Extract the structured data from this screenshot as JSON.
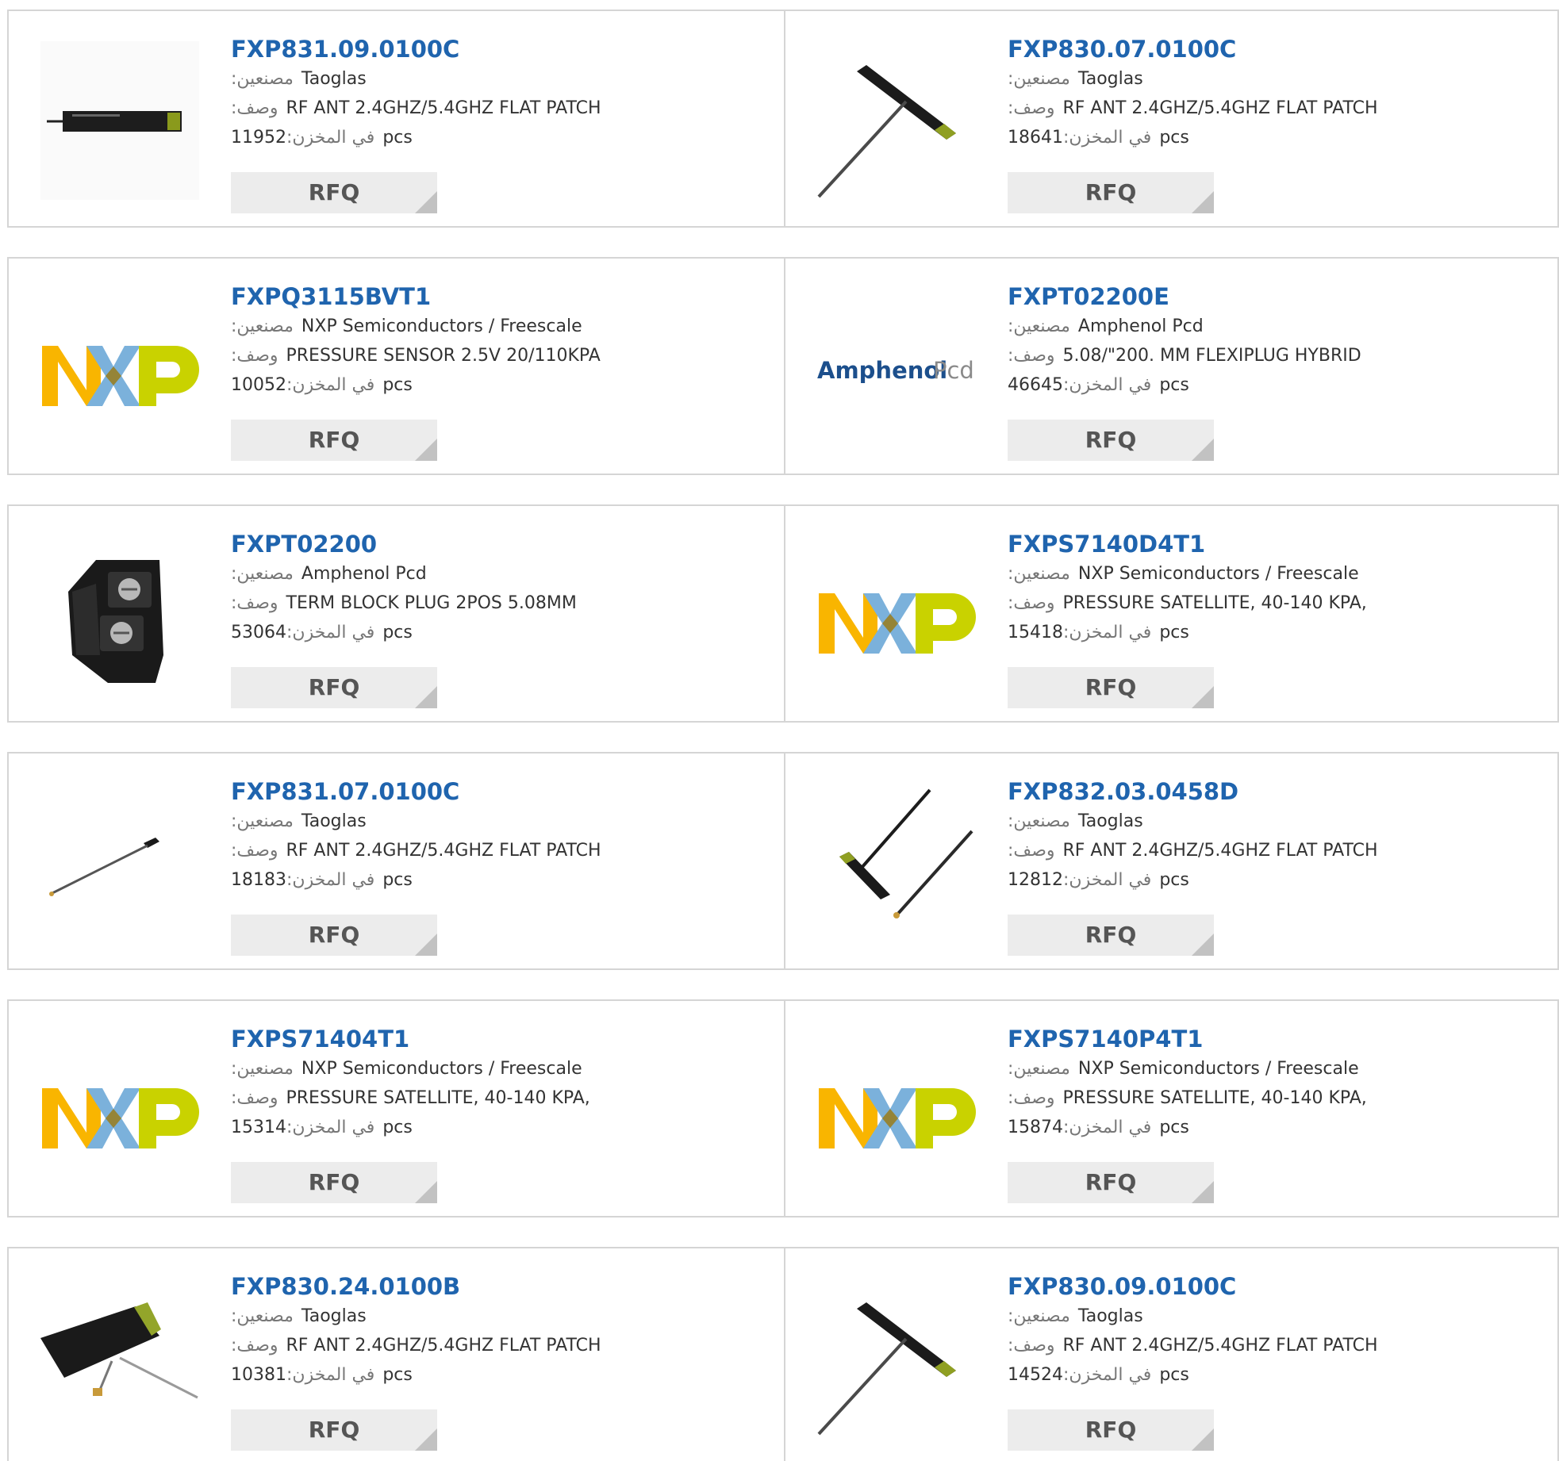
{
  "labels": {
    "manufacturer": "مصنعين",
    "description": "وصف",
    "in_stock": "في المخزن",
    "unit": "pcs",
    "rfq": "RFQ"
  },
  "products": [
    {
      "part": "FXP831.09.0100C",
      "manufacturer": "Taoglas",
      "description": "RF ANT 2.4GHZ/5.4GHZ FLAT PATCH",
      "stock": "11952",
      "image": "flat-patch-antenna-horizontal"
    },
    {
      "part": "FXP830.07.0100C",
      "manufacturer": "Taoglas",
      "description": "RF ANT 2.4GHZ/5.4GHZ FLAT PATCH",
      "stock": "18641",
      "image": "t-antenna-cable"
    },
    {
      "part": "FXPQ3115BVT1",
      "manufacturer": "NXP Semiconductors / Freescale",
      "description": "PRESSURE SENSOR 2.5V 20/110KPA",
      "stock": "10052",
      "image": "nxp-logo"
    },
    {
      "part": "FXPT02200E",
      "manufacturer": "Amphenol Pcd",
      "description": "5.08/\"200. MM FLEXIPLUG HYBRID",
      "stock": "46645",
      "image": "amphenol-pcd-logo",
      "brand_word_1": "Amphenol",
      "brand_word_2": "Pcd"
    },
    {
      "part": "FXPT02200",
      "manufacturer": "Amphenol Pcd",
      "description": "TERM BLOCK PLUG 2POS 5.08MM",
      "stock": "53064",
      "image": "terminal-block"
    },
    {
      "part": "FXPS7140D4T1",
      "manufacturer": "NXP Semiconductors / Freescale",
      "description": "PRESSURE SATELLITE, 40-140 KPA,",
      "stock": "15418",
      "image": "nxp-logo"
    },
    {
      "part": "FXP831.07.0100C",
      "manufacturer": "Taoglas",
      "description": "RF ANT 2.4GHZ/5.4GHZ FLAT PATCH",
      "stock": "18183",
      "image": "thin-antenna-cable"
    },
    {
      "part": "FXP832.03.0458D",
      "manufacturer": "Taoglas",
      "description": "RF ANT 2.4GHZ/5.4GHZ FLAT PATCH",
      "stock": "12812",
      "image": "dual-antenna-cables"
    },
    {
      "part": "FXPS71404T1",
      "manufacturer": "NXP Semiconductors / Freescale",
      "description": "PRESSURE SATELLITE, 40-140 KPA,",
      "stock": "15314",
      "image": "nxp-logo"
    },
    {
      "part": "FXPS7140P4T1",
      "manufacturer": "NXP Semiconductors / Freescale",
      "description": "PRESSURE SATELLITE, 40-140 KPA,",
      "stock": "15874",
      "image": "nxp-logo"
    },
    {
      "part": "FXP830.24.0100B",
      "manufacturer": "Taoglas",
      "description": "RF ANT 2.4GHZ/5.4GHZ FLAT PATCH",
      "stock": "10381",
      "image": "wide-patch-antenna"
    },
    {
      "part": "FXP830.09.0100C",
      "manufacturer": "Taoglas",
      "description": "RF ANT 2.4GHZ/5.4GHZ FLAT PATCH",
      "stock": "14524",
      "image": "t-antenna-cable"
    }
  ]
}
